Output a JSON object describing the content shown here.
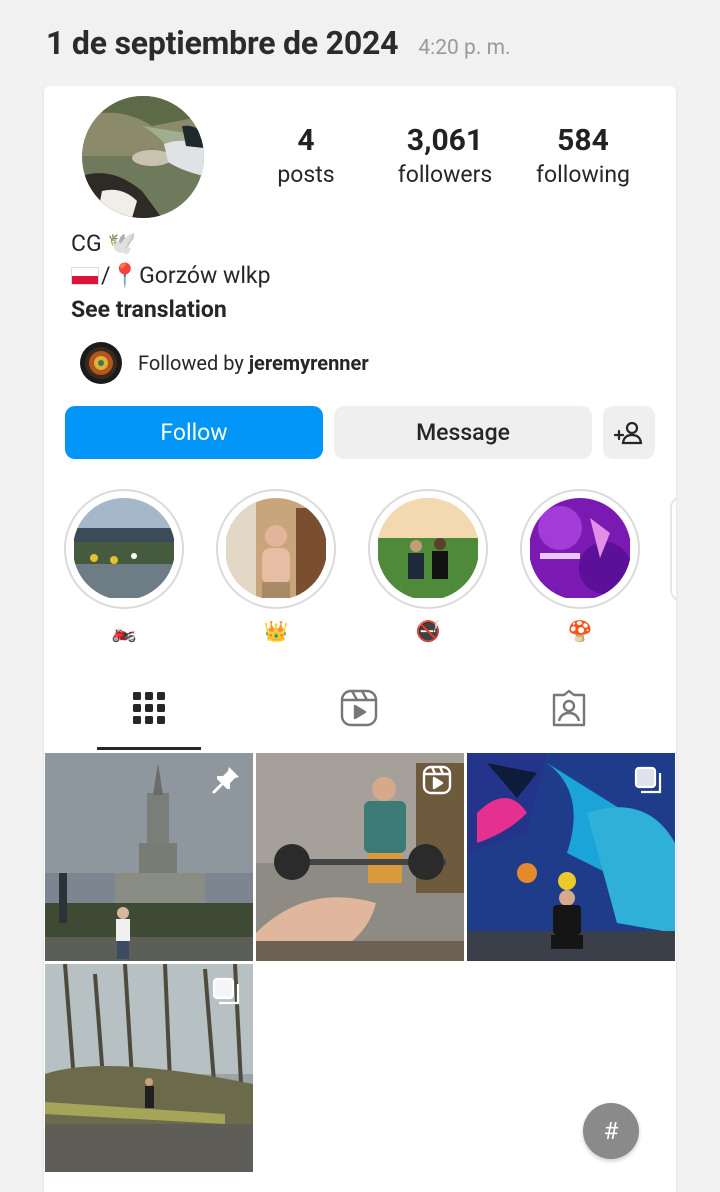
{
  "header": {
    "date": "1 de septiembre de 2024",
    "time": "4:20 p. m."
  },
  "profile": {
    "stats": [
      {
        "value": "4",
        "label": "posts"
      },
      {
        "value": "3,061",
        "label": "followers"
      },
      {
        "value": "584",
        "label": "following"
      }
    ],
    "name": "CG",
    "name_emoji": "🕊️",
    "bio_flag": "🇵🇱",
    "bio_location": "/📍Gorzów wlkp",
    "see_translation": "See translation",
    "followed_by_prefix": "Followed by ",
    "followed_by_user": "jeremyrenner"
  },
  "actions": {
    "follow": "Follow",
    "message": "Message"
  },
  "highlights": [
    {
      "label": "🏍️"
    },
    {
      "label": "👑"
    },
    {
      "label": "🚭"
    },
    {
      "label": "🍄"
    }
  ],
  "tabs": [
    "grid-icon",
    "reels-icon",
    "tagged-icon"
  ],
  "fab": "#"
}
